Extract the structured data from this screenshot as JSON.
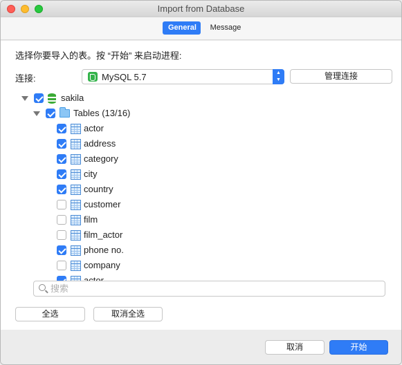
{
  "window": {
    "title": "Import from Database"
  },
  "tabs": [
    {
      "label": "General",
      "active": true
    },
    {
      "label": "Message",
      "active": false
    }
  ],
  "instruction": "选择你要导入的表。按 “开始” 来启动进程:",
  "connection": {
    "label": "连接:",
    "value": "MySQL 5.7",
    "manage_label": "管理连接"
  },
  "tree": {
    "database": {
      "name": "sakila",
      "checked": true
    },
    "group": {
      "name": "Tables (13/16)",
      "checked": true
    },
    "tables": [
      {
        "name": "actor",
        "checked": true
      },
      {
        "name": "address",
        "checked": true
      },
      {
        "name": "category",
        "checked": true
      },
      {
        "name": "city",
        "checked": true
      },
      {
        "name": "country",
        "checked": true
      },
      {
        "name": "customer",
        "checked": false
      },
      {
        "name": "film",
        "checked": false
      },
      {
        "name": "film_actor",
        "checked": false
      },
      {
        "name": "phone no.",
        "checked": true
      },
      {
        "name": "company",
        "checked": false
      },
      {
        "name": "actor",
        "checked": true
      }
    ]
  },
  "search": {
    "placeholder": "搜索",
    "value": ""
  },
  "buttons": {
    "select_all": "全选",
    "deselect_all": "取消全选",
    "cancel": "取消",
    "start": "开始"
  },
  "colors": {
    "accent": "#2f7cf6",
    "db_icon": "#33b34a"
  }
}
